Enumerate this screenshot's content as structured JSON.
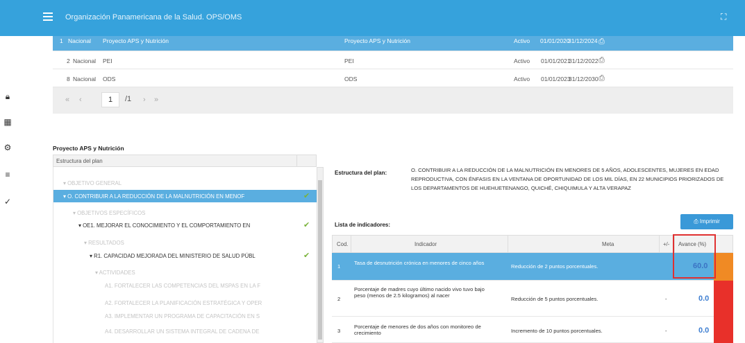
{
  "app": {
    "title": "Organización Panamericana de la Salud. OPS/OMS"
  },
  "rail_icons": [
    "lock-icon",
    "grid-icon",
    "gear-icon",
    "tree-structure-icon",
    "check-icon"
  ],
  "projects": {
    "rows": [
      {
        "num": "1",
        "level": "Nacional",
        "name": "Proyecto APS y Nutrición",
        "plan": "Proyecto APS y Nutrición",
        "status": "Activo",
        "start": "01/01/2020",
        "end": "31/12/2024",
        "selected": true
      },
      {
        "num": "2",
        "level": "Nacional",
        "name": "PEI",
        "plan": "PEI",
        "status": "Activo",
        "start": "01/01/2021",
        "end": "31/12/2022",
        "selected": false
      },
      {
        "num": "8",
        "level": "Nacional",
        "name": "ODS",
        "plan": "ODS",
        "status": "Activo",
        "start": "01/01/2023",
        "end": "31/12/2030",
        "selected": false
      }
    ],
    "pager": {
      "first": "«",
      "prev": "‹",
      "page": "1",
      "total": "/1",
      "next": "›",
      "last": "»"
    }
  },
  "project": {
    "name": "Proyecto APS y Nutrición",
    "tree_header": "Estructura del plan",
    "tree": [
      {
        "text": "▾ OBJETIVO GENERAL",
        "style": "muted",
        "indent": 14,
        "check": false
      },
      {
        "text": "▾ O. CONTRIBUIR A LA REDUCCIÓN DE LA MALNUTRICIÓN EN MENOF",
        "style": "selected",
        "indent": 14,
        "check": true
      },
      {
        "text": "▾ OBJETIVOS ESPECÍFICOS",
        "style": "muted",
        "indent": 28,
        "check": false
      },
      {
        "text": "▾ OE1. MEJORAR EL CONOCIMIENTO Y EL COMPORTAMIENTO EN",
        "style": "dark",
        "indent": 36,
        "check": true
      },
      {
        "text": "▾ RESULTADOS",
        "style": "muted",
        "indent": 44,
        "check": false
      },
      {
        "text": "▾ R1. CAPACIDAD MEJORADA DEL MINISTERIO DE SALUD PÚBL",
        "style": "dark",
        "indent": 52,
        "check": true
      },
      {
        "text": "▾ ACTIVIDADES",
        "style": "muted",
        "indent": 60,
        "check": false
      },
      {
        "text": "A1. FORTALECER LAS COMPETENCIAS DEL MSPAS EN LA F",
        "style": "muted",
        "indent": 74,
        "check": false
      },
      {
        "text": "A2. FORTALECER LA PLANIFICACIÓN ESTRATÉGICA Y OPER",
        "style": "muted",
        "indent": 74,
        "check": false
      },
      {
        "text": "A3. IMPLEMENTAR UN PROGRAMA DE CAPACITACIÓN EN S",
        "style": "muted",
        "indent": 74,
        "check": false
      },
      {
        "text": "A4. DESARROLLAR UN SISTEMA INTEGRAL DE CADENA DE",
        "style": "muted",
        "indent": 74,
        "check": false
      }
    ]
  },
  "estructura": {
    "label": "Estructura del plan:",
    "text": "O. CONTRIBUIR A LA REDUCCIÓN DE LA MALNUTRICIÓN EN MENORES DE 5 AÑOS, ADOLESCENTES, MUJERES EN EDAD REPRODUCTIVA, CON ÉNFASIS EN LA VENTANA DE OPORTUNIDAD DE LOS MIL DÍAS, EN 22 MUNICIPIOS PRIORIZADOS DE LOS DEPARTAMENTOS DE HUEHUETENANGO, QUICHÉ, CHIQUIMULA Y ALTA VERAPAZ"
  },
  "indicadores": {
    "label": "Lista de indicadores:",
    "print_label": "⎙ Imprimir",
    "headers": {
      "cod": "Cod.",
      "indicador": "Indicador",
      "meta": "Meta",
      "sign": "+/-",
      "avance": "Avance (%)"
    },
    "rows": [
      {
        "cod": "1",
        "indicador": "Tasa de desnutrición crónica en menores de cinco años",
        "meta": "Reducción de 2 puntos porcentuales.",
        "sign": "",
        "avance": "60.0",
        "status_color": "#f08a24",
        "selected": true
      },
      {
        "cod": "2",
        "indicador": "Porcentaje de madres cuyo último nacido vivo tuvo bajo peso (menos de 2.5 kilogramos) al nacer",
        "meta": "Reducción de 5 puntos porcentuales.",
        "sign": "-",
        "avance": "0.0",
        "status_color": "#e8302a",
        "selected": false
      },
      {
        "cod": "3",
        "indicador": "Porcentaje de menores de dos años con monitoreo de crecimiento",
        "meta": "Incremento de 10 puntos porcentuales.",
        "sign": "-",
        "avance": "0.0",
        "status_color": "#e8302a",
        "selected": false
      }
    ]
  },
  "colors": {
    "primary": "#36a2dc",
    "selected": "#5aaee0",
    "check": "#7ab33a",
    "warn": "#f08a24",
    "danger": "#e8302a",
    "highlight": "#e03030"
  }
}
